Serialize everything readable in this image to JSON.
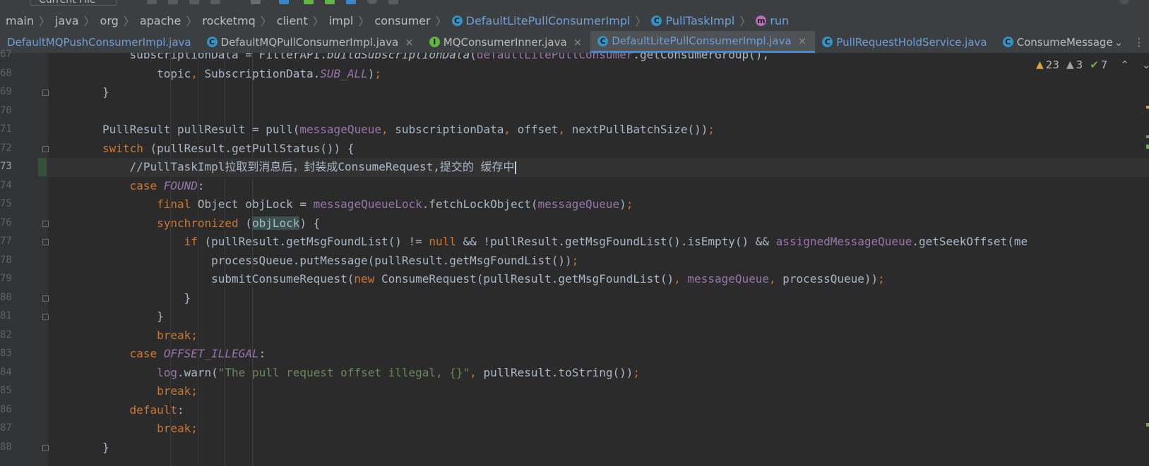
{
  "toolbar": {
    "run_config": "Current File",
    "run_config_tail": "run"
  },
  "breadcrumb": [
    {
      "label": "main",
      "badge": ""
    },
    {
      "label": "java",
      "badge": ""
    },
    {
      "label": "org",
      "badge": ""
    },
    {
      "label": "apache",
      "badge": ""
    },
    {
      "label": "rocketmq",
      "badge": ""
    },
    {
      "label": "client",
      "badge": ""
    },
    {
      "label": "impl",
      "badge": ""
    },
    {
      "label": "consumer",
      "badge": ""
    },
    {
      "label": "DefaultLitePullConsumerImpl",
      "badge": "C"
    },
    {
      "label": "PullTaskImpl",
      "badge": "C"
    },
    {
      "label": "run",
      "badge": "m"
    }
  ],
  "tabs": [
    {
      "label": "DefaultMQPushConsumerImpl.java",
      "badge": "",
      "modified": true,
      "active": false,
      "closable": false
    },
    {
      "label": "DefaultMQPullConsumerImpl.java",
      "badge": "C",
      "modified": false,
      "active": false,
      "closable": true
    },
    {
      "label": "MQConsumerInner.java",
      "badge": "I",
      "modified": false,
      "active": false,
      "closable": true
    },
    {
      "label": "DefaultLitePullConsumerImpl.java",
      "badge": "C",
      "modified": true,
      "active": true,
      "closable": true
    },
    {
      "label": "PullRequestHoldService.java",
      "badge": "C",
      "modified": true,
      "active": false,
      "closable": false
    },
    {
      "label": "ConsumeMessage",
      "badge": "C",
      "modified": false,
      "active": false,
      "closable": false
    }
  ],
  "tab_overflow": {
    "dropdown": "chevron-down",
    "more": "more-vertical"
  },
  "inspections": {
    "warnings": "23",
    "weak_warnings": "3",
    "typos": "7"
  },
  "code": {
    "current_line": "73",
    "lines": [
      {
        "num": "67",
        "indent": 6,
        "tokens": [
          [
            "p",
            "subscriptionData = FilterAPI."
          ],
          [
            "ital",
            "buildSubscriptionData"
          ],
          [
            "p",
            "("
          ],
          [
            "fld",
            "defaultLitePullConsumer"
          ],
          [
            "p",
            ".getConsumerGroup(),"
          ]
        ]
      },
      {
        "num": "68",
        "indent": 7,
        "tokens": [
          [
            "p",
            "topic"
          ],
          [
            "kw",
            ", "
          ],
          [
            "p",
            "SubscriptionData."
          ],
          [
            "fldi",
            "SUB_ALL"
          ],
          [
            "p",
            ")"
          ],
          [
            "kw",
            ";"
          ]
        ]
      },
      {
        "num": "69",
        "indent": 5,
        "tokens": [
          [
            "p",
            "}"
          ]
        ]
      },
      {
        "num": "70",
        "indent": 0,
        "tokens": []
      },
      {
        "num": "71",
        "indent": 5,
        "tokens": [
          [
            "p",
            "PullResult pullResult = pull("
          ],
          [
            "fld",
            "messageQueue"
          ],
          [
            "kw",
            ", "
          ],
          [
            "p",
            "subscriptionData"
          ],
          [
            "kw",
            ", "
          ],
          [
            "p",
            "offset"
          ],
          [
            "kw",
            ", "
          ],
          [
            "p",
            "nextPullBatchSize())"
          ],
          [
            "kw",
            ";"
          ]
        ]
      },
      {
        "num": "72",
        "indent": 5,
        "tokens": [
          [
            "kw",
            "switch "
          ],
          [
            "p",
            "(pullResult.getPullStatus()) {"
          ]
        ]
      },
      {
        "num": "73",
        "indent": 6,
        "tokens": [
          [
            "cmt",
            "//PullTaskImpl拉取到消息后，封装成ConsumeRequest,提交的 缓存中"
          ],
          [
            "caret",
            ""
          ]
        ]
      },
      {
        "num": "74",
        "indent": 6,
        "tokens": [
          [
            "kw",
            "case "
          ],
          [
            "fldi",
            "FOUND"
          ],
          [
            "p",
            ":"
          ]
        ]
      },
      {
        "num": "75",
        "indent": 7,
        "tokens": [
          [
            "kw",
            "final "
          ],
          [
            "p",
            "Object objLock = "
          ],
          [
            "fld",
            "messageQueueLock"
          ],
          [
            "p",
            ".fetchLockObject("
          ],
          [
            "fld",
            "messageQueue"
          ],
          [
            "p",
            ")"
          ],
          [
            "kw",
            ";"
          ]
        ]
      },
      {
        "num": "76",
        "indent": 7,
        "tokens": [
          [
            "kw",
            "synchronized "
          ],
          [
            "p",
            "("
          ],
          [
            "hl",
            "objLock"
          ],
          [
            "p",
            ") {"
          ]
        ]
      },
      {
        "num": "77",
        "indent": 8,
        "tokens": [
          [
            "kw",
            "if "
          ],
          [
            "p",
            "(pullResult.getMsgFoundList() != "
          ],
          [
            "kw",
            "null "
          ],
          [
            "p",
            "&& !pullResult.getMsgFoundList().isEmpty() && "
          ],
          [
            "fld",
            "assignedMessageQueue"
          ],
          [
            "p",
            ".getSeekOffset(me"
          ]
        ]
      },
      {
        "num": "78",
        "indent": 9,
        "tokens": [
          [
            "p",
            "processQueue.putMessage(pullResult.getMsgFoundList())"
          ],
          [
            "kw",
            ";"
          ]
        ]
      },
      {
        "num": "79",
        "indent": 9,
        "tokens": [
          [
            "p",
            "submitConsumeRequest("
          ],
          [
            "kw",
            "new "
          ],
          [
            "p",
            "ConsumeRequest(pullResult.getMsgFoundList()"
          ],
          [
            "kw",
            ", "
          ],
          [
            "fld",
            "messageQueue"
          ],
          [
            "kw",
            ", "
          ],
          [
            "p",
            "processQueue))"
          ],
          [
            "kw",
            ";"
          ]
        ]
      },
      {
        "num": "80",
        "indent": 8,
        "tokens": [
          [
            "p",
            "}"
          ]
        ]
      },
      {
        "num": "81",
        "indent": 7,
        "tokens": [
          [
            "p",
            "}"
          ]
        ]
      },
      {
        "num": "82",
        "indent": 7,
        "tokens": [
          [
            "kw",
            "break;"
          ]
        ]
      },
      {
        "num": "83",
        "indent": 6,
        "tokens": [
          [
            "kw",
            "case "
          ],
          [
            "fldi",
            "OFFSET_ILLEGAL"
          ],
          [
            "p",
            ":"
          ]
        ]
      },
      {
        "num": "84",
        "indent": 7,
        "tokens": [
          [
            "fld",
            "log"
          ],
          [
            "p",
            ".warn("
          ],
          [
            "str",
            "\"The pull request offset illegal, {}\""
          ],
          [
            "kw",
            ", "
          ],
          [
            "p",
            "pullResult.toString())"
          ],
          [
            "kw",
            ";"
          ]
        ]
      },
      {
        "num": "85",
        "indent": 7,
        "tokens": [
          [
            "kw",
            "break;"
          ]
        ]
      },
      {
        "num": "86",
        "indent": 6,
        "tokens": [
          [
            "kw",
            "default"
          ],
          [
            "p",
            ":"
          ]
        ]
      },
      {
        "num": "87",
        "indent": 7,
        "tokens": [
          [
            "kw",
            "break;"
          ]
        ]
      },
      {
        "num": "88",
        "indent": 5,
        "tokens": [
          [
            "p",
            "}"
          ]
        ]
      }
    ]
  }
}
